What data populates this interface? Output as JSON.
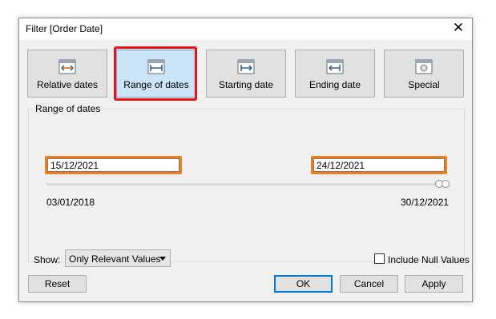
{
  "window": {
    "title": "Filter [Order Date]"
  },
  "modes": [
    {
      "label": "Relative dates",
      "icon": "calendar-arrows-icon",
      "selected": false
    },
    {
      "label": "Range of dates",
      "icon": "calendar-range-icon",
      "selected": true
    },
    {
      "label": "Starting date",
      "icon": "calendar-start-icon",
      "selected": false
    },
    {
      "label": "Ending date",
      "icon": "calendar-end-icon",
      "selected": false
    },
    {
      "label": "Special",
      "icon": "calendar-special-icon",
      "selected": false
    }
  ],
  "range": {
    "group_label": "Range of dates",
    "start_value": "15/12/2021",
    "end_value": "24/12/2021",
    "min_label": "03/01/2018",
    "max_label": "30/12/2021"
  },
  "footer": {
    "show_label": "Show:",
    "show_value": "Only Relevant Values",
    "include_null_label": "Include Null Values",
    "include_null_checked": false
  },
  "buttons": {
    "reset": "Reset",
    "ok": "OK",
    "cancel": "Cancel",
    "apply": "Apply"
  },
  "colors": {
    "highlight_red": "#e2151a",
    "highlight_orange": "#f07f1a",
    "selected_bg": "#cce4f7",
    "accent_blue": "#0078d7"
  }
}
